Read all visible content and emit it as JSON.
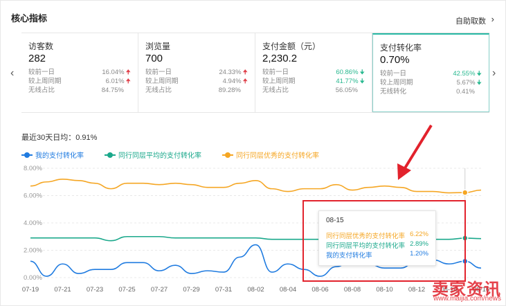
{
  "header": {
    "title": "核心指标",
    "auto_label": "自助取数",
    "auto_arrow": "›"
  },
  "nav": {
    "prev": "‹",
    "next": "›"
  },
  "cards": [
    {
      "title": "访客数",
      "value": "282",
      "rows": [
        {
          "label": "较前一日",
          "value": "16.04%",
          "dir": "up"
        },
        {
          "label": "较上周同期",
          "value": "6.01%",
          "dir": "up"
        },
        {
          "label": "无线占比",
          "value": "84.75%",
          "dir": ""
        }
      ]
    },
    {
      "title": "浏览量",
      "value": "700",
      "rows": [
        {
          "label": "较前一日",
          "value": "24.33%",
          "dir": "up"
        },
        {
          "label": "较上周同期",
          "value": "4.94%",
          "dir": "up"
        },
        {
          "label": "无线占比",
          "value": "89.28%",
          "dir": ""
        }
      ]
    },
    {
      "title": "支付金额（元）",
      "value": "2,230.2",
      "rows": [
        {
          "label": "较前一日",
          "value": "60.86%",
          "dir": "down"
        },
        {
          "label": "较上周同期",
          "value": "41.77%",
          "dir": "down"
        },
        {
          "label": "无线占比",
          "value": "56.05%",
          "dir": ""
        }
      ]
    },
    {
      "title": "支付转化率",
      "value": "0.70%",
      "rows": [
        {
          "label": "较前一日",
          "value": "42.55%",
          "dir": "down"
        },
        {
          "label": "较上周同期",
          "value": "5.67%",
          "dir": "down"
        },
        {
          "label": "无线转化",
          "value": "0.41%",
          "dir": ""
        }
      ]
    }
  ],
  "summary": "最近30天日均：0.91%",
  "legend": [
    {
      "name": "我的支付转化率",
      "color": "#1f7be0"
    },
    {
      "name": "同行同层平均的支付转化率",
      "color": "#1aa88b"
    },
    {
      "name": "同行同层优秀的支付转化率",
      "color": "#f5a623"
    }
  ],
  "tooltip": {
    "date": "08-15",
    "rows": [
      {
        "name": "同行同层优秀的支付转化率",
        "value": "6.22%"
      },
      {
        "name": "同行同层平均的支付转化率",
        "value": "2.89%"
      },
      {
        "name": "我的支付转化率",
        "value": "1.20%"
      }
    ]
  },
  "watermark": {
    "text": "卖家资讯",
    "url": "www.maijia.com/news"
  },
  "chart_data": {
    "type": "line",
    "x": [
      "07-19",
      "07-20",
      "07-21",
      "07-22",
      "07-23",
      "07-24",
      "07-25",
      "07-26",
      "07-27",
      "07-28",
      "07-29",
      "07-30",
      "07-31",
      "08-01",
      "08-02",
      "08-03",
      "08-04",
      "08-05",
      "08-06",
      "08-07",
      "08-08",
      "08-09",
      "08-10",
      "08-11",
      "08-12",
      "08-13",
      "08-14",
      "08-15",
      "08-16"
    ],
    "xticks": [
      "07-19",
      "07-21",
      "07-23",
      "07-25",
      "07-27",
      "07-29",
      "07-31",
      "08-02",
      "08-04",
      "08-06",
      "08-08",
      "08-10",
      "08-12",
      "08-14",
      "08-16"
    ],
    "yticks": [
      "0.00%",
      "2.00%",
      "4.00%",
      "6.00%",
      "8.00%"
    ],
    "ylim": [
      0,
      8
    ],
    "series": [
      {
        "name": "同行同层优秀的支付转化率",
        "color": "#f5a623",
        "values": [
          6.7,
          7.0,
          7.2,
          7.1,
          6.9,
          6.5,
          6.9,
          6.9,
          6.8,
          6.9,
          6.8,
          6.6,
          6.6,
          6.9,
          7.1,
          6.5,
          6.3,
          6.5,
          6.5,
          6.8,
          6.4,
          6.6,
          6.7,
          6.6,
          6.3,
          6.3,
          6.2,
          6.22,
          6.4
        ]
      },
      {
        "name": "同行同层平均的支付转化率",
        "color": "#1aa88b",
        "values": [
          2.9,
          2.9,
          2.9,
          2.9,
          2.9,
          2.7,
          3.0,
          3.0,
          3.0,
          2.9,
          2.9,
          2.9,
          2.9,
          2.9,
          2.9,
          2.8,
          2.8,
          2.8,
          2.8,
          2.8,
          2.8,
          2.8,
          2.8,
          2.8,
          2.8,
          2.8,
          2.8,
          2.89,
          2.85
        ]
      },
      {
        "name": "我的支付转化率",
        "color": "#1f7be0",
        "values": [
          1.2,
          0.1,
          1.0,
          0.3,
          0.6,
          0.6,
          1.1,
          1.1,
          0.5,
          0.9,
          0.3,
          0.5,
          0.4,
          1.5,
          2.4,
          0.4,
          1.0,
          0.6,
          0.1,
          0.8,
          1.3,
          1.0,
          0.7,
          0.7,
          1.2,
          1.3,
          1.0,
          1.2,
          0.7
        ]
      }
    ]
  }
}
